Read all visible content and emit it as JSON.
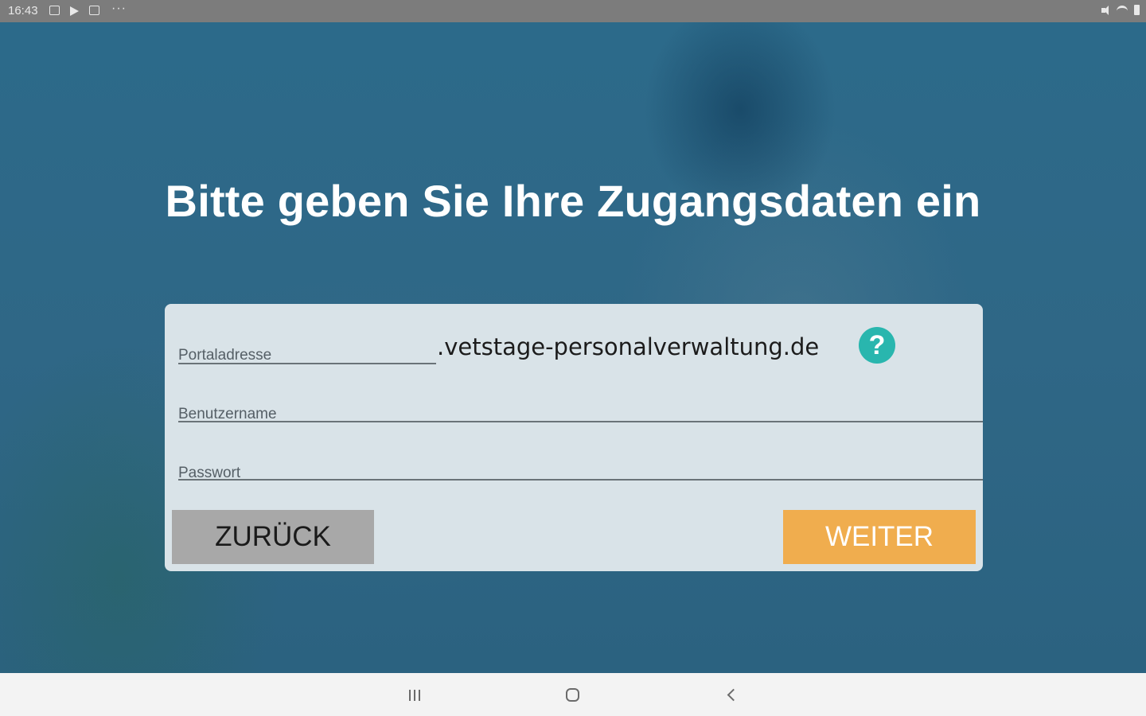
{
  "status_bar": {
    "time": "16:43",
    "left_icons": [
      "gallery-icon",
      "play-icon",
      "cast-icon"
    ],
    "overflow": "···",
    "right_icons": [
      "mute-icon",
      "wifi-icon",
      "battery-icon"
    ]
  },
  "login": {
    "headline": "Bitte geben Sie Ihre Zugangsdaten ein",
    "portal_label": "Portaladresse",
    "portal_suffix": ".vetstage-personalverwaltung.de",
    "help_symbol": "?",
    "username_label": "Benutzername",
    "password_label": "Passwort",
    "back_button": "ZURÜCK",
    "next_button": "WEITER"
  },
  "colors": {
    "background": "#2f6887",
    "card": "#d9e3e8",
    "help_icon": "#29b6ae",
    "back_button": "#a8a8a8",
    "next_button": "#f0ad4e"
  },
  "nav_bar": {
    "icons": [
      "recent-apps-icon",
      "home-icon",
      "back-icon"
    ]
  }
}
